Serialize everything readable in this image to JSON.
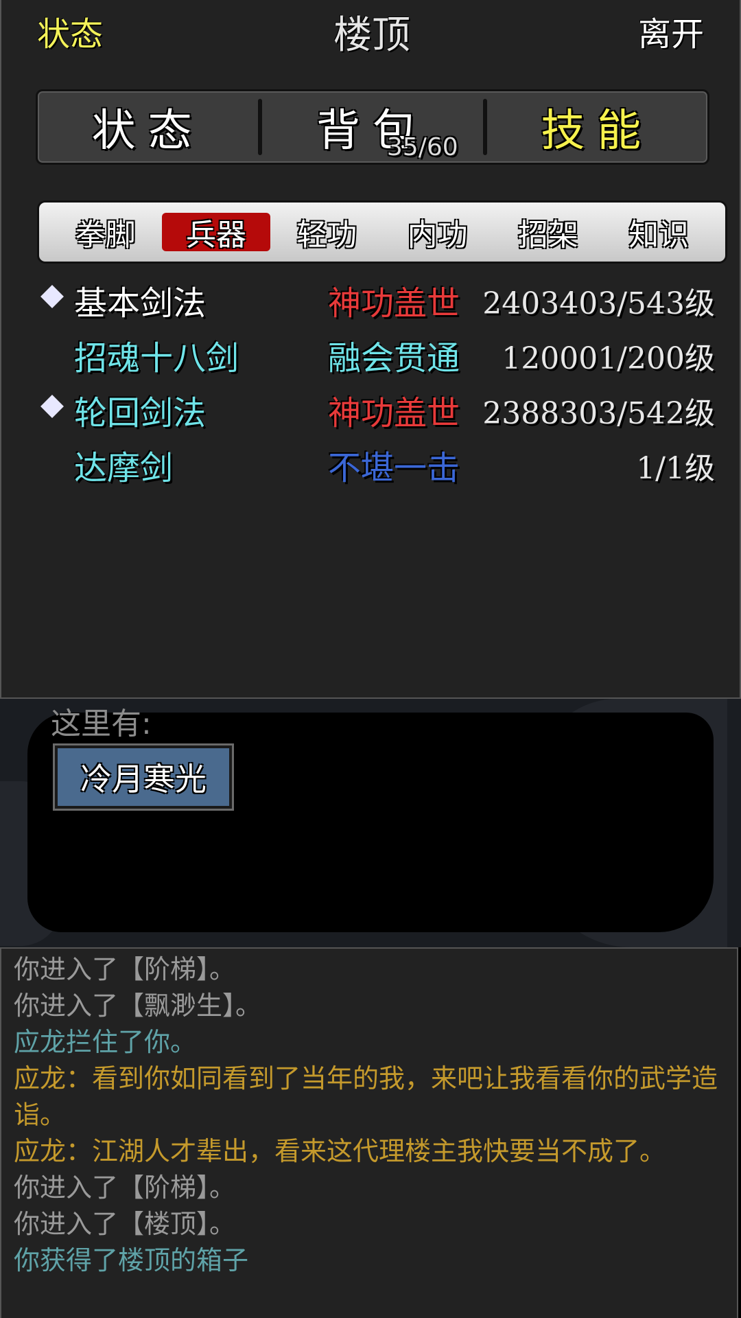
{
  "header": {
    "status_label": "状态",
    "title": "楼顶",
    "leave_label": "离开"
  },
  "main_tabs": [
    {
      "label": "状态"
    },
    {
      "label": "背包",
      "count": "35/60"
    },
    {
      "label": "技能"
    }
  ],
  "sub_tabs": [
    "拳脚",
    "兵器",
    "轻功",
    "内功",
    "招架",
    "知识"
  ],
  "skills": [
    {
      "name": "基本剑法",
      "name_color": "#ffffff",
      "level": "神功盖世",
      "level_color": "#e83a3a",
      "progress": "2403403/543级",
      "equipped": true
    },
    {
      "name": "招魂十八剑",
      "name_color": "#6fe3e8",
      "level": "融会贯通",
      "level_color": "#6fe3e8",
      "progress": "120001/200级",
      "equipped": false
    },
    {
      "name": "轮回剑法",
      "name_color": "#6fe3e8",
      "level": "神功盖世",
      "level_color": "#e83a3a",
      "progress": "2388303/542级",
      "equipped": true
    },
    {
      "name": "达摩剑",
      "name_color": "#6fe3e8",
      "level": "不堪一击",
      "level_color": "#3b67d6",
      "progress": "1/1级",
      "equipped": false
    }
  ],
  "scene": {
    "here_label": "这里有:",
    "npc_button": "冷月寒光"
  },
  "log": [
    {
      "text": "你进入了【阶梯】。",
      "color": "gray"
    },
    {
      "text": "你进入了【飘渺生】。",
      "color": "gray"
    },
    {
      "text": "应龙拦住了你。",
      "color": "teal"
    },
    {
      "text": "应龙：看到你如同看到了当年的我，来吧让我看看你的武学造诣。",
      "color": "gold"
    },
    {
      "text": "应龙：江湖人才辈出，看来这代理楼主我快要当不成了。",
      "color": "gold"
    },
    {
      "text": "你进入了【阶梯】。",
      "color": "gray"
    },
    {
      "text": "你进入了【楼顶】。",
      "color": "gray"
    },
    {
      "text": "你获得了楼顶的箱子",
      "color": "teal"
    }
  ]
}
